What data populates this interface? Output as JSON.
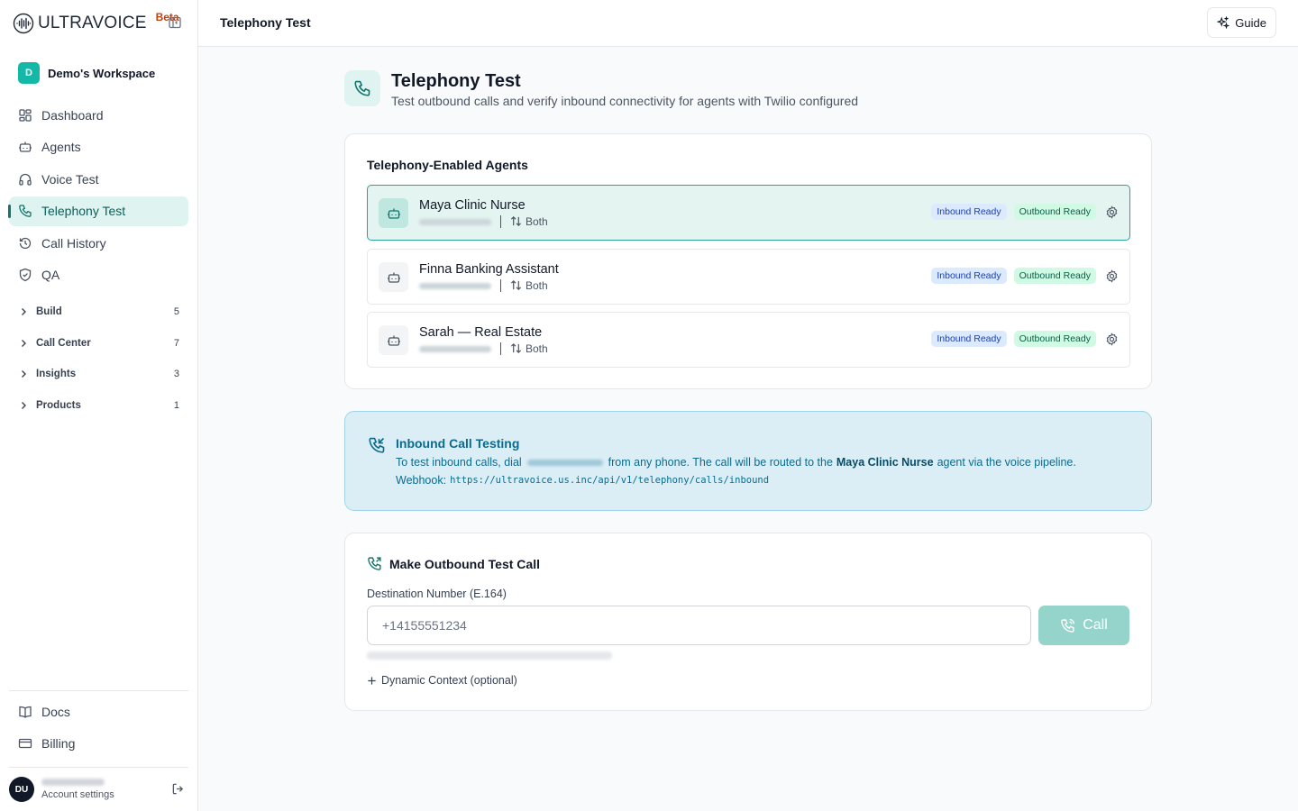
{
  "brand": {
    "name": "ULTRAVOICE",
    "badge": "Beta"
  },
  "workspace": {
    "initial": "D",
    "name": "Demo's Workspace"
  },
  "nav": {
    "items": [
      {
        "label": "Dashboard",
        "icon": "dashboard-icon"
      },
      {
        "label": "Agents",
        "icon": "bot-icon"
      },
      {
        "label": "Voice Test",
        "icon": "headphones-icon"
      },
      {
        "label": "Telephony Test",
        "icon": "phone-icon",
        "active": true
      },
      {
        "label": "Call History",
        "icon": "history-icon"
      },
      {
        "label": "QA",
        "icon": "shield-check-icon"
      }
    ],
    "groups": [
      {
        "label": "Build",
        "count": "5"
      },
      {
        "label": "Call Center",
        "count": "7"
      },
      {
        "label": "Insights",
        "count": "3"
      },
      {
        "label": "Products",
        "count": "1"
      }
    ],
    "bottom": [
      {
        "label": "Docs",
        "icon": "book-icon"
      },
      {
        "label": "Billing",
        "icon": "credit-card-icon"
      }
    ]
  },
  "account": {
    "initials": "DU",
    "settings_label": "Account settings"
  },
  "topbar": {
    "title": "Telephony Test",
    "guide_label": "Guide"
  },
  "page": {
    "title": "Telephony Test",
    "subtitle": "Test outbound calls and verify inbound connectivity for agents with Twilio configured"
  },
  "agents_card": {
    "title": "Telephony-Enabled Agents",
    "agents": [
      {
        "name": "Maya Clinic Nurse",
        "direction": "Both",
        "inbound": "Inbound Ready",
        "outbound": "Outbound Ready",
        "selected": true
      },
      {
        "name": "Finna Banking Assistant",
        "direction": "Both",
        "inbound": "Inbound Ready",
        "outbound": "Outbound Ready",
        "selected": false
      },
      {
        "name": "Sarah — Real Estate",
        "direction": "Both",
        "inbound": "Inbound Ready",
        "outbound": "Outbound Ready",
        "selected": false
      }
    ]
  },
  "inbound": {
    "title": "Inbound Call Testing",
    "text_prefix": "To test inbound calls, dial",
    "text_mid": "from any phone. The call will be routed to the",
    "agent_name": "Maya Clinic Nurse",
    "text_suffix": "agent via the voice pipeline.",
    "webhook_label": "Webhook:",
    "webhook_url": "https://ultravoice.us.inc/api/v1/telephony/calls/inbound"
  },
  "outbound": {
    "title": "Make Outbound Test Call",
    "field_label": "Destination Number (E.164)",
    "placeholder": "+14155551234",
    "call_label": "Call",
    "dynamic_context_label": "Dynamic Context (optional)"
  },
  "colors": {
    "accent": "#0f766e",
    "accent_bg": "#dff3f0",
    "inbound_bg": "#dbeef6",
    "call_button": "#94d4cb"
  }
}
